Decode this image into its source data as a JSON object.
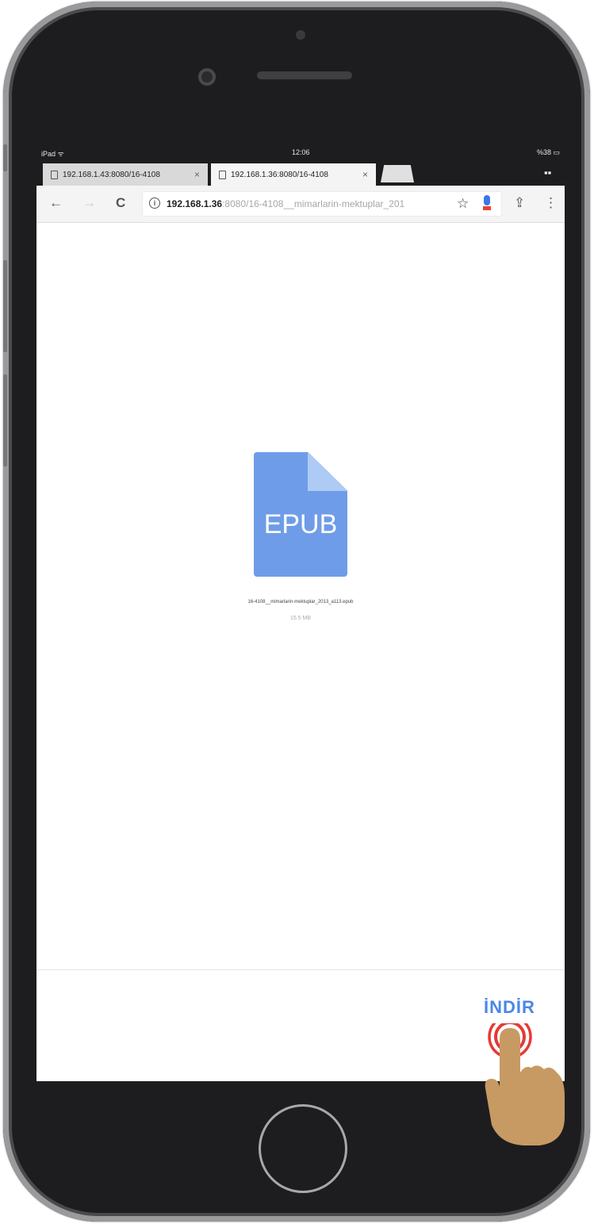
{
  "status_bar": {
    "device": "iPad ᯤ",
    "time": "12:06",
    "battery": "%38 ▭"
  },
  "tabs": [
    {
      "label": "192.168.1.43:8080/16-4108",
      "close": "×",
      "active": false
    },
    {
      "label": "192.168.1.36:8080/16-4108",
      "close": "×",
      "active": true
    }
  ],
  "toolbar": {
    "back": "←",
    "forward": "→",
    "reload": "C",
    "url_host": "192.168.1.36",
    "url_rest": ":8080/16-4108__mimarlarin-mektuplar_201",
    "bookmark": "☆",
    "share": "⇪",
    "menu": "⋮"
  },
  "file": {
    "type": "EPUB",
    "name": "16-4108__mimarlarin-mektuplar_2013_a113.epub",
    "size": "15.5 MB",
    "icon_color": "#6f9ce8"
  },
  "footer": {
    "download_label": "İNDİR",
    "accent": "#4a86e8"
  },
  "icons": {
    "tab_grid": "tab-switcher-icon",
    "tap": "tap-hand-icon",
    "tap_color": "#e53935"
  }
}
